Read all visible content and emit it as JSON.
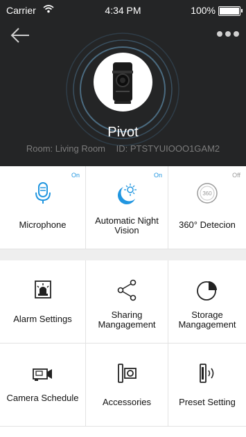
{
  "status_bar": {
    "carrier": "Carrier",
    "time": "4:34 PM",
    "battery": "100%"
  },
  "header": {
    "back_icon": "back-arrow-icon",
    "more_icon": "more-dots-icon",
    "device_name": "Pivot",
    "room": "Room: Living Room",
    "device_id": "ID: PTSTYUIOOO1GAM2"
  },
  "features": [
    {
      "label": "Microphone",
      "state": "On",
      "icon": "microphone-icon"
    },
    {
      "label": "Automatic Night Vision",
      "state": "On",
      "icon": "night-vision-icon"
    },
    {
      "label": "360° Detecion",
      "state": "Off",
      "icon": "360-detection-icon"
    }
  ],
  "settings": [
    {
      "label": "Alarm Settings",
      "icon": "alarm-icon"
    },
    {
      "label": "Sharing Mangagement",
      "icon": "share-icon"
    },
    {
      "label": "Storage Mangagement",
      "icon": "storage-pie-icon"
    },
    {
      "label": "Camera Schedule",
      "icon": "camera-schedule-icon"
    },
    {
      "label": "Accessories",
      "icon": "accessories-icon"
    },
    {
      "label": "Preset Setting",
      "icon": "preset-icon"
    }
  ],
  "colors": {
    "header_bg": "#242526",
    "accent": "#2196e0",
    "section_gap": "#eeeeee"
  }
}
